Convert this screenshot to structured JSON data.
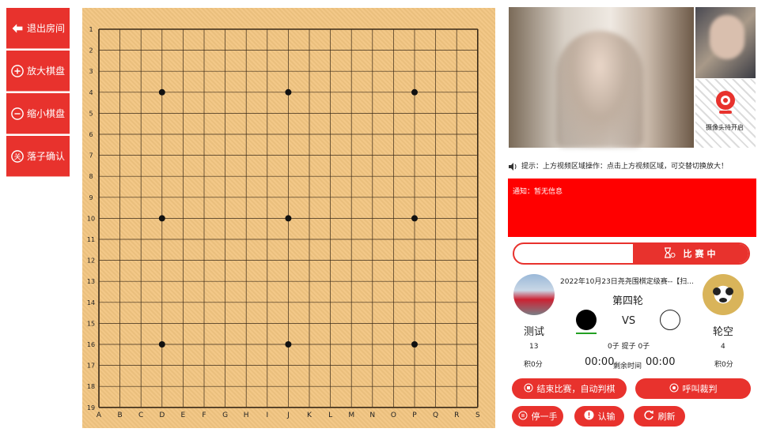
{
  "left_buttons": [
    {
      "label": "退出房间",
      "icon": "exit-icon"
    },
    {
      "label": "放大棋盘",
      "icon": "zoom-in-icon"
    },
    {
      "label": "缩小棋盘",
      "icon": "zoom-out-icon"
    },
    {
      "label": "落子确认",
      "icon": "confirm-icon"
    }
  ],
  "board": {
    "size": 19,
    "row_labels": [
      "1",
      "2",
      "3",
      "4",
      "5",
      "6",
      "7",
      "8",
      "9",
      "10",
      "11",
      "12",
      "13",
      "14",
      "15",
      "16",
      "17",
      "18",
      "19"
    ],
    "col_labels": [
      "A",
      "B",
      "C",
      "D",
      "E",
      "F",
      "G",
      "H",
      "I",
      "J",
      "K",
      "L",
      "M",
      "N",
      "O",
      "P",
      "Q",
      "R",
      "S"
    ],
    "star_points": [
      [
        "D",
        "4"
      ],
      [
        "J",
        "4"
      ],
      [
        "P",
        "4"
      ],
      [
        "D",
        "10"
      ],
      [
        "J",
        "10"
      ],
      [
        "P",
        "10"
      ],
      [
        "D",
        "16"
      ],
      [
        "J",
        "16"
      ],
      [
        "P",
        "16"
      ]
    ]
  },
  "video": {
    "camera_waiting_label": "摄像头待开启"
  },
  "tip": {
    "text": "提示：上方视频区域操作：点击上方视频区域，可交替切换放大！"
  },
  "notice": {
    "text": "通知：暂无信息"
  },
  "status_bar": {
    "label": "比赛中"
  },
  "match": {
    "title": "2022年10月23日尧尧围棋定级赛--【扫...",
    "round": "第四轮",
    "vs": "VS",
    "captures": "0子 提子 0子",
    "left_time": "00:00",
    "time_label": "剩余时间",
    "right_time": "00:00",
    "player_black": {
      "name": "测试",
      "rank": "13",
      "score": "积0分"
    },
    "player_white": {
      "name": "轮空",
      "rank": "4",
      "score": "积0分"
    }
  },
  "actions": {
    "end_match": "结束比赛，自动判棋",
    "call_referee": "呼叫裁判",
    "pass": "停一手",
    "resign": "认输",
    "refresh": "刷新"
  },
  "colors": {
    "accent": "#e8322d",
    "notice_bg": "#ff0000",
    "board": "#f2c581"
  }
}
